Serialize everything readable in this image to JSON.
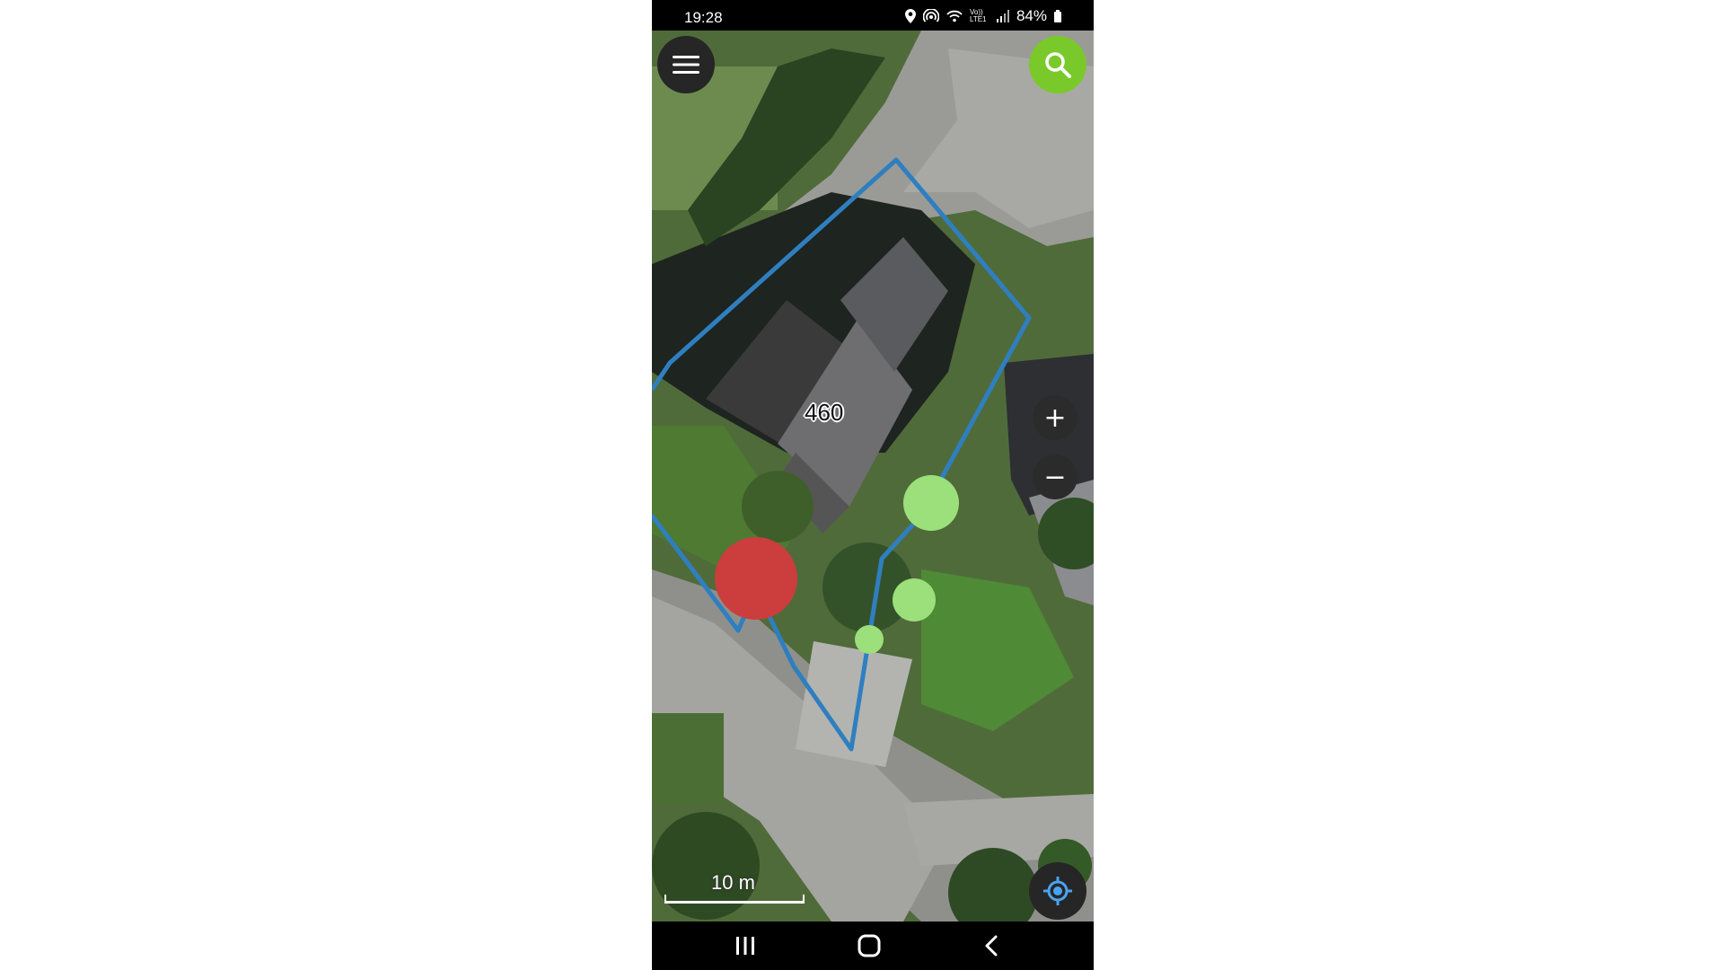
{
  "status_bar": {
    "time": "19:28",
    "battery": "84%",
    "network": "Vo)) LTE1",
    "icons": [
      "location-icon",
      "hotspot-icon",
      "wifi-icon",
      "signal-icon",
      "battery-icon"
    ]
  },
  "map": {
    "parcel_number": "460",
    "scale_label": "10 m",
    "boundary_color": "#2f7fc0",
    "markers": [
      {
        "color": "#cc3d3d",
        "type": "red-marker"
      },
      {
        "color": "#9be07a",
        "type": "green-marker"
      },
      {
        "color": "#9be07a",
        "type": "green-marker"
      },
      {
        "color": "#9be07a",
        "type": "green-marker"
      }
    ]
  },
  "controls": {
    "menu_icon": "hamburger-menu-icon",
    "search_icon": "search-icon",
    "zoom_in": "+",
    "zoom_out": "−",
    "locate_icon": "crosshair-locate-icon",
    "search_color": "#7ac92a"
  },
  "nav_bar": {
    "icons": [
      "recents-icon",
      "home-icon",
      "back-icon"
    ]
  }
}
